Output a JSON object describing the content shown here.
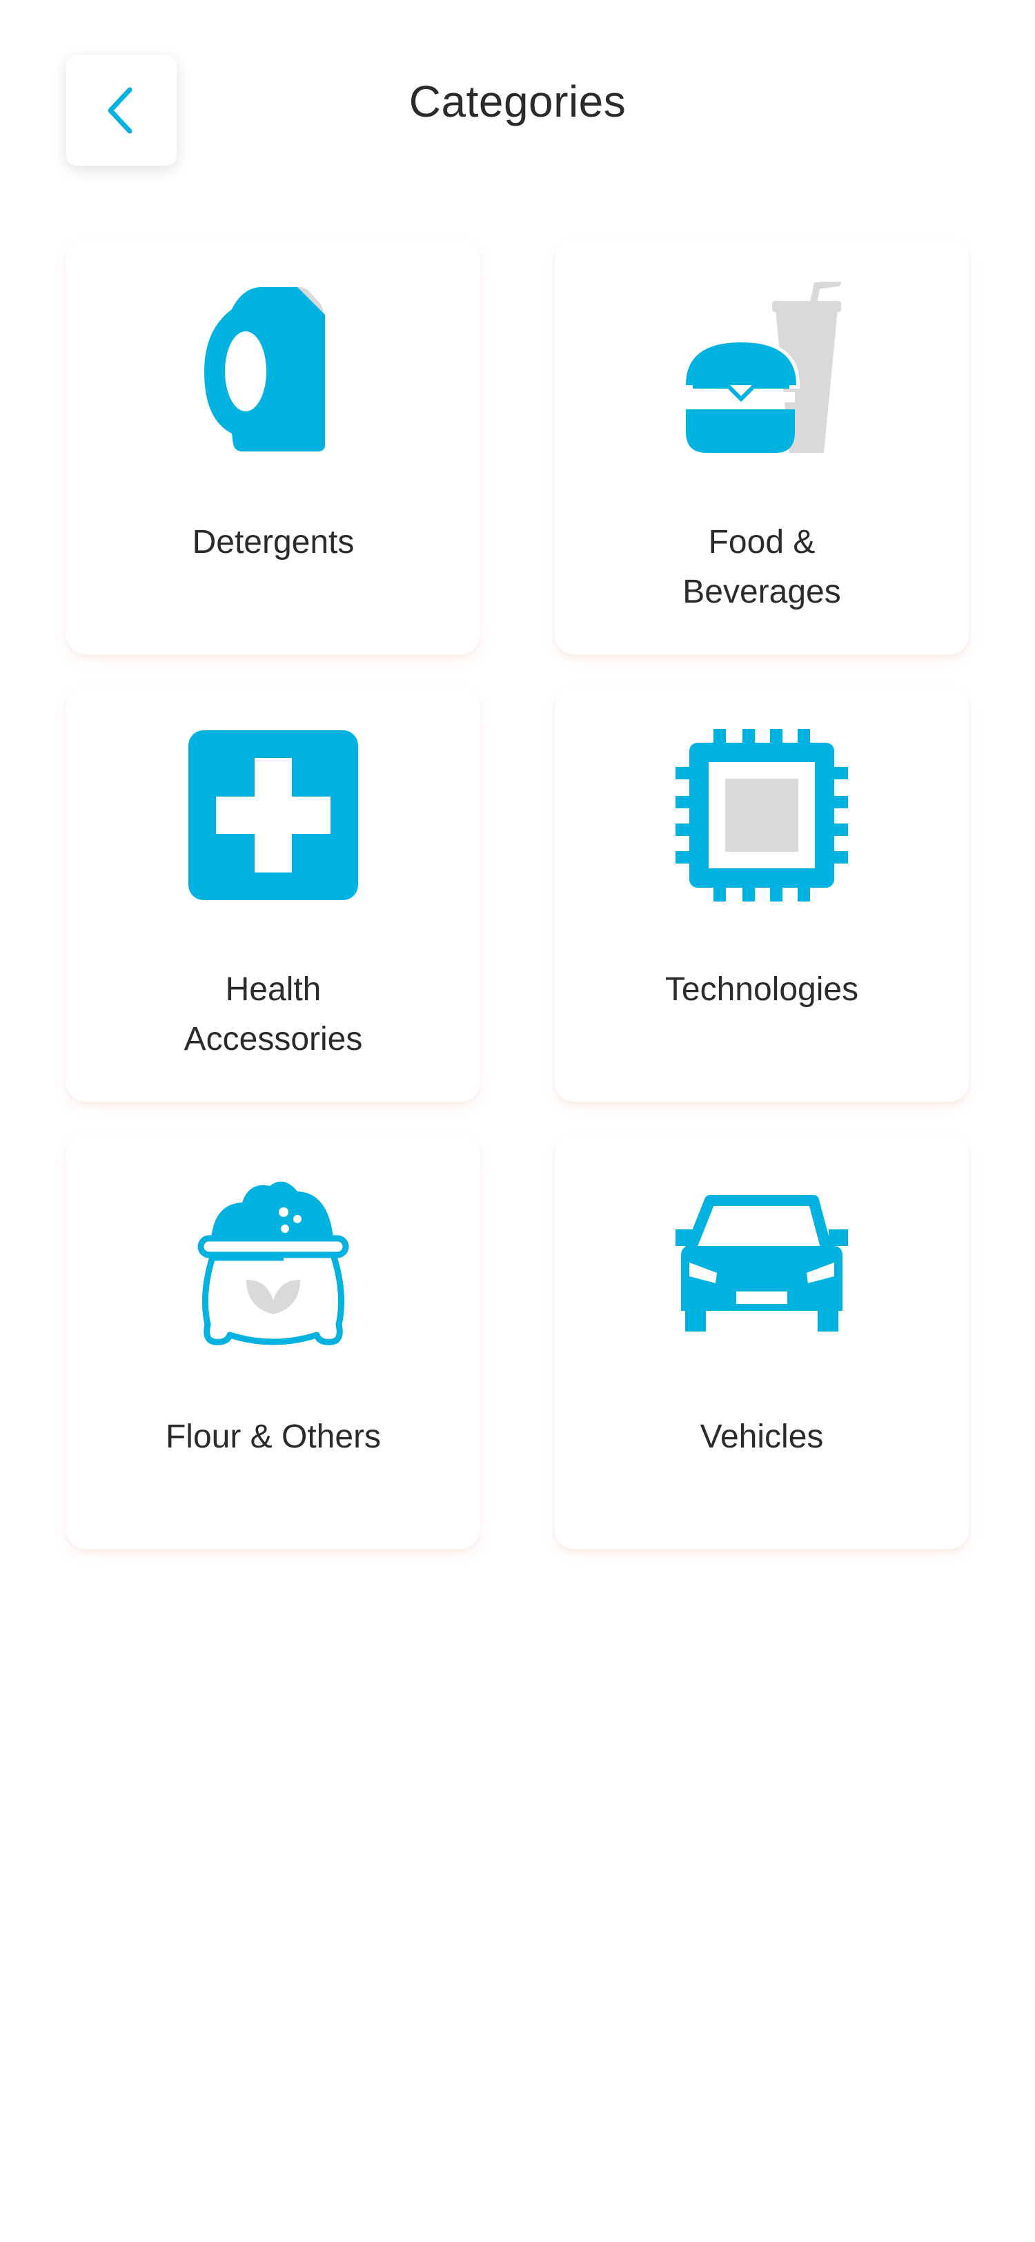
{
  "header": {
    "title": "Categories",
    "back_icon": "chevron-left-icon"
  },
  "colors": {
    "accent": "#00B2E0",
    "icon_secondary": "#D9D9D9",
    "text": "#2B2B2B",
    "background": "#FFFFFF"
  },
  "categories": [
    {
      "label_lines": [
        "Detergents"
      ],
      "icon": "detergent-bottle-icon"
    },
    {
      "label_lines": [
        "Food &",
        "Beverages"
      ],
      "icon": "burger-drink-icon"
    },
    {
      "label_lines": [
        "Health",
        "Accessories"
      ],
      "icon": "medical-cross-icon"
    },
    {
      "label_lines": [
        "Technologies"
      ],
      "icon": "cpu-chip-icon"
    },
    {
      "label_lines": [
        "Flour & Others"
      ],
      "icon": "flour-sack-icon"
    },
    {
      "label_lines": [
        "Vehicles"
      ],
      "icon": "car-icon"
    }
  ]
}
